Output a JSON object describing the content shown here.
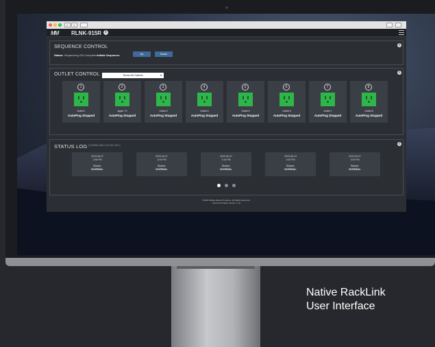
{
  "browser": {
    "traffic_lights": [
      "#ff5f57",
      "#febc2e",
      "#28c840"
    ],
    "nav_back": "‹",
    "nav_forward": "›"
  },
  "app": {
    "logo": "MM",
    "device_name": "RLNK-915R",
    "info_glyph": "i"
  },
  "sequence": {
    "title": "SEQUENCE CONTROL",
    "status_label": "Status:",
    "status_value": "Sequencing ON Complete",
    "initiate_label": "Initiate Sequence:",
    "up_label": "Up",
    "down_label": "Down"
  },
  "outlet_control": {
    "title": "OUTLET CONTROL",
    "filter_value": "Show All Outlets",
    "outlets": [
      {
        "number": "1",
        "name": "Outlet 1",
        "state": "AutoPing Stopped"
      },
      {
        "number": "2",
        "name": "Apple TV",
        "state": "AutoPing Stopped"
      },
      {
        "number": "3",
        "name": "Outlet 3",
        "state": "AutoPing Stopped"
      },
      {
        "number": "4",
        "name": "Outlet 4",
        "state": "AutoPing Stopped"
      },
      {
        "number": "5",
        "name": "Outlet 5",
        "state": "AutoPing Stopped"
      },
      {
        "number": "6",
        "name": "Outlet 6",
        "state": "AutoPing Stopped"
      },
      {
        "number": "7",
        "name": "Outlet 7",
        "state": "AutoPing Stopped"
      },
      {
        "number": "8",
        "name": "Outlet 8",
        "state": "AutoPing Stopped"
      }
    ],
    "outlet_on_color": "#2fb64a"
  },
  "status_log": {
    "title": "STATUS LOG",
    "download_link": "[ DOWNLOAD LOG AS CSV ]",
    "entries": [
      {
        "date": "2023-06-07",
        "time": "2:38 PM",
        "status_label": "Status:",
        "status": "NORMAL"
      },
      {
        "date": "2023-06-07",
        "time": "2:09 PM",
        "status_label": "Status:",
        "status": "NORMAL"
      },
      {
        "date": "2023-06-07",
        "time": "2:16 PM",
        "status_label": "Status:",
        "status": "NORMAL"
      },
      {
        "date": "2023-06-13",
        "time": "2:09 PM",
        "status_label": "Status:",
        "status": "NORMAL"
      },
      {
        "date": "2023-06-07",
        "time": "2:09 PM",
        "status_label": "Status:",
        "status": "NORMAL"
      }
    ],
    "page_count": 3,
    "active_page": 1
  },
  "footer": {
    "copyright": "©2023 Middle Atlantic Products. All Rights Reserved.",
    "firmware": "Current Firmware Version: 1.47"
  },
  "caption": {
    "line1": "Native RackLink",
    "line2": "User Interface"
  }
}
